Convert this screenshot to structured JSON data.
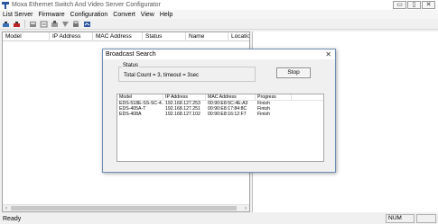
{
  "window": {
    "title": "Moxa Ethernet Switch And Video Server Configurator",
    "controls": [
      "▭",
      "▯",
      "✕"
    ]
  },
  "menu": [
    "List Server",
    "Firmware",
    "Configuration",
    "Convert",
    "View",
    "Help"
  ],
  "toolbar": {
    "icons": [
      "search-icon",
      "broadcast-icon",
      "network-icon",
      "config-icon",
      "upload-icon",
      "export-icon",
      "lock-icon",
      "unlock-icon"
    ]
  },
  "list": {
    "columns": [
      "Model",
      "IP Address",
      "MAC Address",
      "Status",
      "Name",
      "Locatio"
    ]
  },
  "statusbar": {
    "text": "Ready",
    "indicator": "NUM"
  },
  "dialog": {
    "title": "Broadcast Search",
    "close": "✕",
    "status_group_label": "Status",
    "total_count": "Total Count = 3, timeout = 3sec",
    "stop_label": "Stop",
    "columns": [
      "Model",
      "IP Address",
      "MAC Address",
      "Progress"
    ],
    "rows": [
      [
        "EDS-518E-SS-SC-4...",
        "192.168.127.253",
        "00:90:E8:5C:4E:A3",
        "Finish"
      ],
      [
        "EDS-405A-T",
        "192.168.127.251",
        "00:90:E8:17:84:8C",
        "Finish"
      ],
      [
        "EDS-408A",
        "192.168.127.102",
        "00:90:E8:16:12:F7",
        "Finish"
      ]
    ]
  }
}
